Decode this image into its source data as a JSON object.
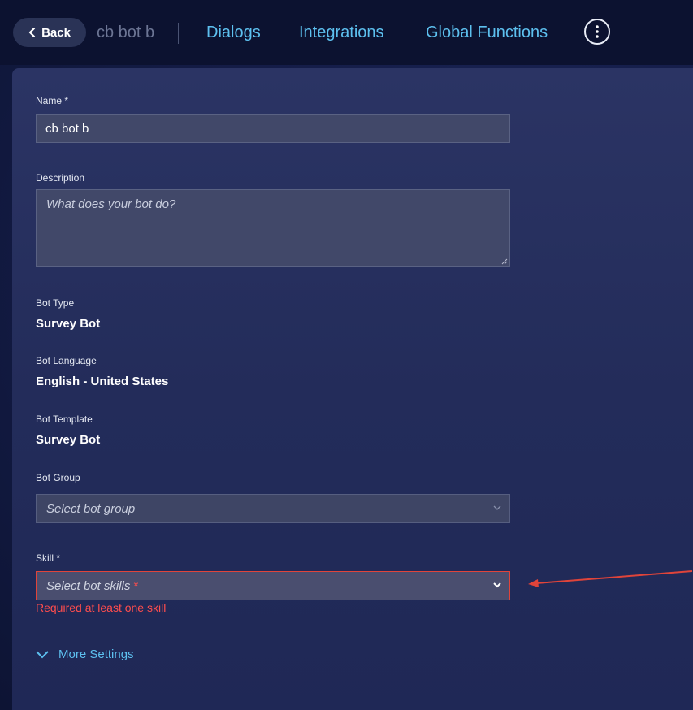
{
  "header": {
    "back_label": "Back",
    "bot_name": "cb bot b",
    "nav": [
      "Dialogs",
      "Integrations",
      "Global Functions"
    ]
  },
  "form": {
    "name_label": "Name *",
    "name_value": "cb bot b",
    "description_label": "Description",
    "description_placeholder": "What does your bot do?",
    "bot_type_label": "Bot Type",
    "bot_type_value": "Survey Bot",
    "bot_language_label": "Bot Language",
    "bot_language_value": "English - United States",
    "bot_template_label": "Bot Template",
    "bot_template_value": "Survey Bot",
    "bot_group_label": "Bot Group",
    "bot_group_placeholder": "Select bot group",
    "skill_label": "Skill *",
    "skill_placeholder": "Select bot skills",
    "skill_required_mark": "*",
    "skill_error": "Required at least one skill",
    "more_settings_label": "More Settings"
  },
  "colors": {
    "accent": "#5dc0ef",
    "error": "#ff4d4d",
    "annotation_arrow": "#e0443a"
  },
  "icons": {
    "back": "chevron-left-icon",
    "more": "vertical-dots-icon",
    "dropdown": "chevron-down-icon",
    "more_settings": "chevron-down-icon",
    "annotation": "red-arrow-icon"
  }
}
